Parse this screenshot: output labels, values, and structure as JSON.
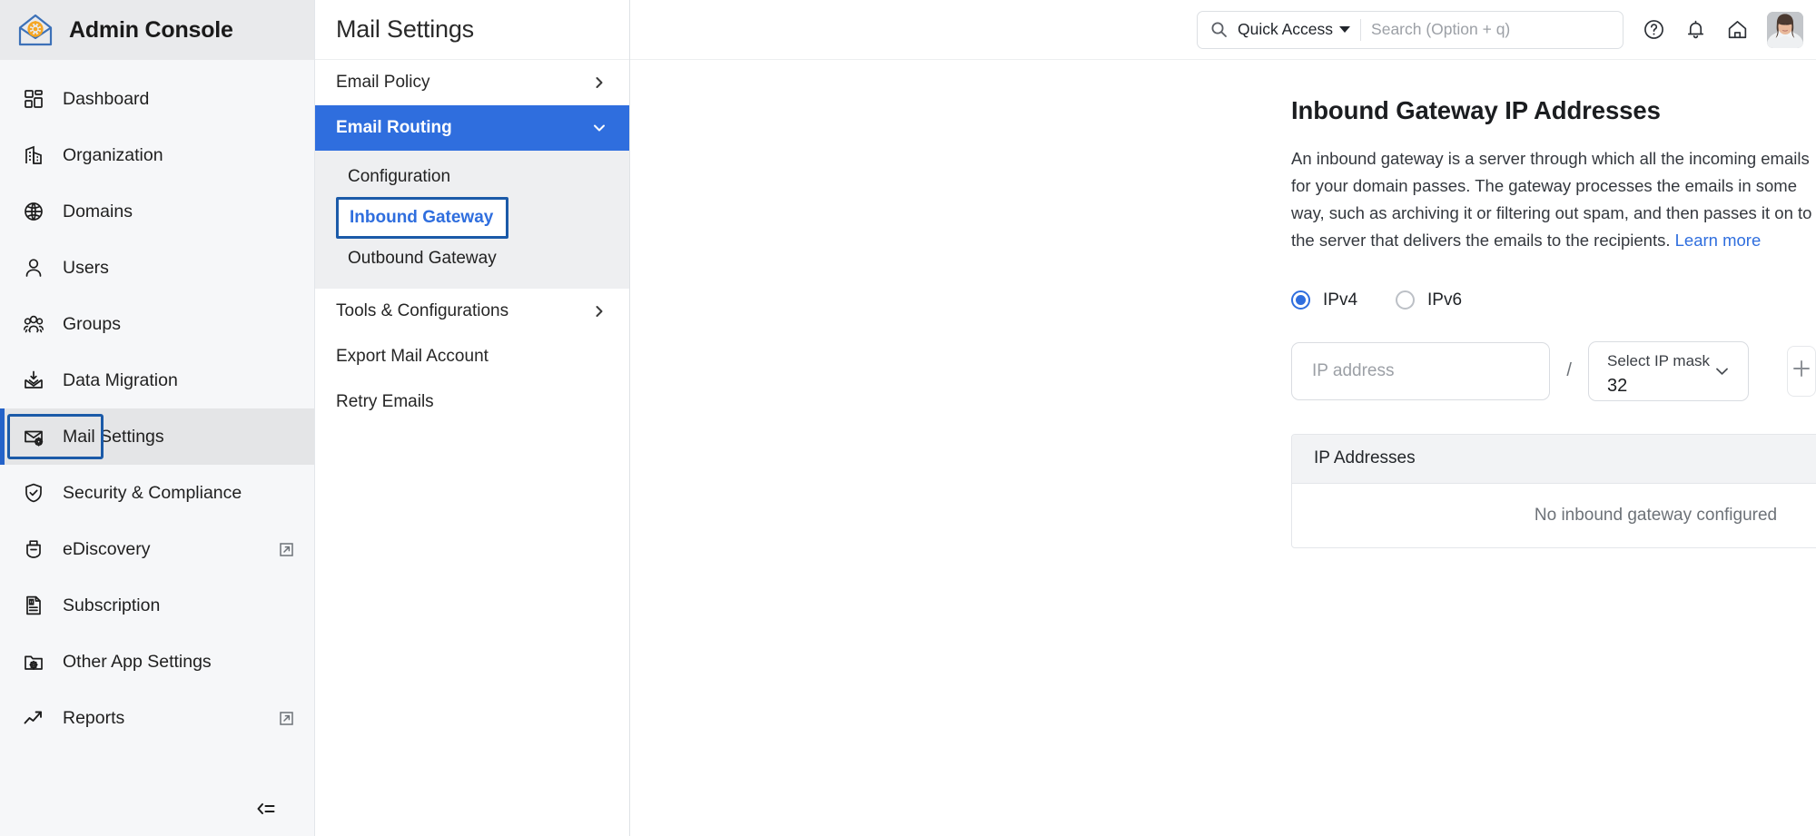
{
  "brand": {
    "title": "Admin Console",
    "logo_icon": "house-gear-icon"
  },
  "sidebar": {
    "items": [
      {
        "label": "Dashboard",
        "icon": "grid-icon",
        "selected": false,
        "external": false
      },
      {
        "label": "Organization",
        "icon": "building-icon",
        "selected": false,
        "external": false
      },
      {
        "label": "Domains",
        "icon": "globe-icon",
        "selected": false,
        "external": false
      },
      {
        "label": "Users",
        "icon": "user-icon",
        "selected": false,
        "external": false
      },
      {
        "label": "Groups",
        "icon": "users-group-icon",
        "selected": false,
        "external": false
      },
      {
        "label": "Data Migration",
        "icon": "envelope-download-icon",
        "selected": false,
        "external": false
      },
      {
        "label": "Mail Settings",
        "icon": "envelope-gear-icon",
        "selected": true,
        "external": false
      },
      {
        "label": "Security & Compliance",
        "icon": "shield-check-icon",
        "selected": false,
        "external": false
      },
      {
        "label": "eDiscovery",
        "icon": "briefcase-icon",
        "selected": false,
        "external": true
      },
      {
        "label": "Subscription",
        "icon": "invoice-dollar-icon",
        "selected": false,
        "external": false
      },
      {
        "label": "Other App Settings",
        "icon": "folder-gear-icon",
        "selected": false,
        "external": false
      },
      {
        "label": "Reports",
        "icon": "trend-arrow-icon",
        "selected": false,
        "external": true
      }
    ],
    "collapse_icon": "collapse-panel-icon"
  },
  "panel2": {
    "title": "Mail Settings",
    "rows": [
      {
        "label": "Email Policy",
        "chevron": "chevron-right-icon",
        "active": false
      },
      {
        "label": "Email Routing",
        "chevron": "chevron-down-icon",
        "active": true
      }
    ],
    "sub_rows": [
      {
        "label": "Configuration",
        "focused": false
      },
      {
        "label": "Inbound Gateway",
        "focused": true
      },
      {
        "label": "Outbound Gateway",
        "focused": false
      }
    ],
    "rows_after": [
      {
        "label": "Tools & Configurations",
        "chevron": "chevron-right-icon",
        "active": false
      },
      {
        "label": "Export Mail Account",
        "chevron": "",
        "active": false
      },
      {
        "label": "Retry Emails",
        "chevron": "",
        "active": false
      }
    ]
  },
  "topbar": {
    "quick_access_label": "Quick Access",
    "search_placeholder": "Search (Option + q)",
    "search_value": "",
    "search_icon": "search-icon",
    "icons": [
      {
        "name": "help-circle-icon"
      },
      {
        "name": "bell-icon"
      },
      {
        "name": "home-icon"
      }
    ],
    "avatar": "user-avatar"
  },
  "main": {
    "heading": "Inbound Gateway IP Addresses",
    "description": "An inbound gateway is a server through which all the incoming emails for your domain passes. The gateway processes the emails in some way, such as archiving it or filtering out spam, and then passes it on to the server that delivers the emails to the recipients.",
    "learn_more": "Learn more",
    "radios": [
      {
        "label": "IPv4",
        "selected": true
      },
      {
        "label": "IPv6",
        "selected": false
      }
    ],
    "ip_input": {
      "placeholder": "IP address",
      "value": ""
    },
    "separator": "/",
    "mask": {
      "label": "Select IP mask",
      "value": "32",
      "chevron": "chevron-down-icon"
    },
    "add_button": "plus-icon",
    "table": {
      "header": "IP Addresses",
      "empty_text": "No inbound gateway configured"
    }
  },
  "colors": {
    "accent_blue": "#2f6ede",
    "focus_blue": "#1b5aa8",
    "sidebar_bg": "#f6f7f9",
    "brand_bg": "#e9eaec",
    "logo_orange": "#f5a623",
    "logo_blue": "#3c71b8"
  }
}
